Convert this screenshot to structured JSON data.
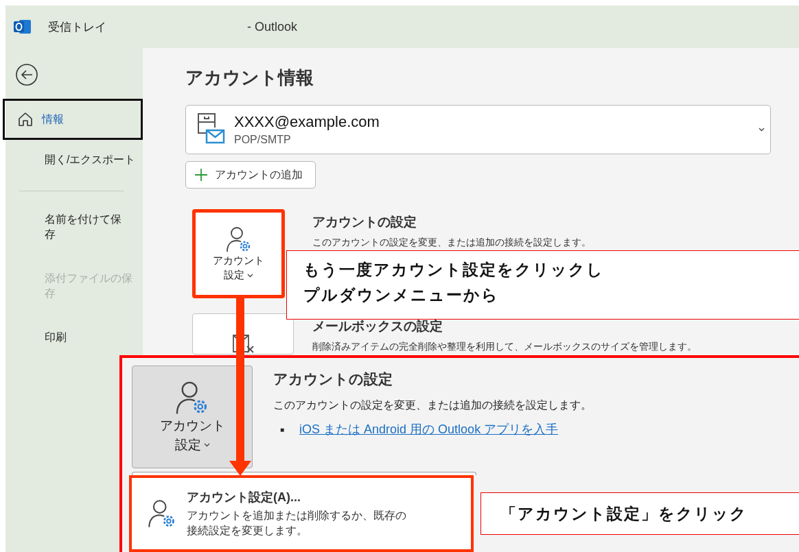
{
  "window": {
    "title": "受信トレイ",
    "app_name": "-  Outlook"
  },
  "sidebar": {
    "items": [
      {
        "kind": "home",
        "label_lines": [
          "情報"
        ],
        "selected": true,
        "disabled": false
      },
      {
        "kind": "nav",
        "label_lines": [
          "開く/エクスポート"
        ],
        "selected": false,
        "disabled": false
      },
      {
        "kind": "divider"
      },
      {
        "kind": "nav",
        "label_lines": [
          "名前を付けて保",
          "存"
        ],
        "selected": false,
        "disabled": false
      },
      {
        "kind": "nav",
        "label_lines": [
          "添付ファイルの保",
          "存"
        ],
        "selected": false,
        "disabled": true
      },
      {
        "kind": "nav",
        "label_lines": [
          "印刷"
        ],
        "selected": false,
        "disabled": false
      }
    ]
  },
  "main": {
    "title": "アカウント情報",
    "account": {
      "email": "XXXX@example.com",
      "type": "POP/SMTP"
    },
    "add_button": "アカウントの追加",
    "sections": [
      {
        "kind": "account",
        "button_lines": [
          "アカウント",
          "設定"
        ],
        "highlighted": true,
        "heading": "アカウントの設定",
        "description": "このアカウントの設定を変更、または追加の接続を設定します。"
      },
      {
        "kind": "mailbox",
        "highlighted": false,
        "heading": "メールボックスの設定",
        "description": "削除済みアイテムの完全削除や整理を利用して、メールボックスのサイズを管理します。"
      }
    ]
  },
  "inset": {
    "button_lines": [
      "アカウント",
      "設定"
    ],
    "heading": "アカウントの設定",
    "description": "このアカウントの設定を変更、または追加の接続を設定します。",
    "bullet": "■",
    "link": "iOS または Android 用の Outlook アプリを入手",
    "menu_item": {
      "title": "アカウント設定(A)...",
      "description_lines": [
        "アカウントを追加または削除するか、既存の",
        "接続設定を変更します。"
      ],
      "highlighted": true
    }
  },
  "annotations": [
    {
      "lines": [
        "もう一度アカウント設定をクリックし",
        "プルダウンメニューから"
      ]
    },
    {
      "lines": [
        "「アカウント設定」をクリック"
      ]
    }
  ]
}
